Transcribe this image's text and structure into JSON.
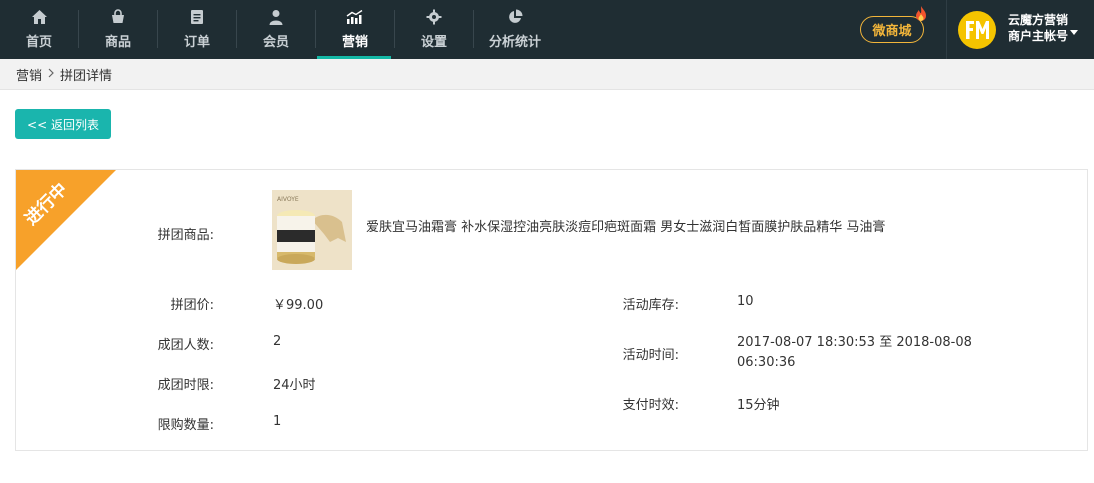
{
  "nav": {
    "items": [
      {
        "label": "首页",
        "icon": "home-icon"
      },
      {
        "label": "商品",
        "icon": "basket-icon"
      },
      {
        "label": "订单",
        "icon": "clipboard-icon"
      },
      {
        "label": "会员",
        "icon": "user-icon"
      },
      {
        "label": "营销",
        "icon": "trend-chart-icon"
      },
      {
        "label": "设置",
        "icon": "gear-icon"
      },
      {
        "label": "分析统计",
        "icon": "pie-chart-icon"
      }
    ],
    "active_index": 4
  },
  "header": {
    "shop_label": "微商城",
    "account_name": "云魔方营销",
    "account_role": "商户主帐号"
  },
  "breadcrumb": {
    "parent": "营销",
    "current": "拼团详情"
  },
  "back_label": "<< 返回列表",
  "status_ribbon": "进行中",
  "detail": {
    "product_label": "拼团商品:",
    "product_name": "爱肤宜马油霜膏 补水保湿控油亮肤淡痘印疤斑面霜 男女士滋润白皙面膜护肤品精华 马油膏",
    "image_brand_text": "AIVOYE",
    "price_label": "拼团价:",
    "price_value": "￥99.00",
    "group_size_label": "成团人数:",
    "group_size_value": "2",
    "time_limit_label": "成团时限:",
    "time_limit_value": "24小时",
    "purchase_limit_label": "限购数量:",
    "purchase_limit_value": "1",
    "stock_label": "活动库存:",
    "stock_value": "10",
    "activity_time_label": "活动时间:",
    "activity_time_line1": "2017-08-07 18:30:53 至 2018-08-08",
    "activity_time_line2": "06:30:36",
    "pay_timeout_label": "支付时效:",
    "pay_timeout_value": "15分钟"
  },
  "colors": {
    "topbar": "#1f2d33",
    "accent": "#14b8a6",
    "ribbon": "#f7a12a",
    "shop_button": "#f2b53a"
  }
}
